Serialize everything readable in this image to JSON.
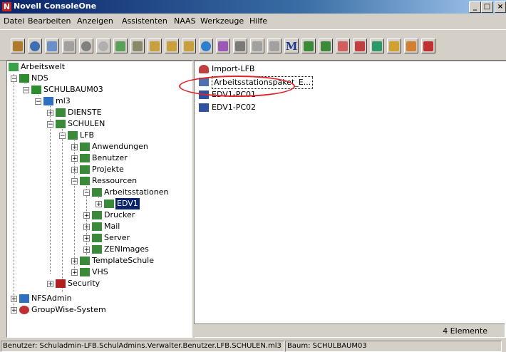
{
  "window": {
    "title": "Novell ConsoleOne",
    "app_icon": "N",
    "minimize": "_",
    "maximize": "□",
    "close": "×"
  },
  "menu": [
    "Datei",
    "Bearbeiten",
    "Anzeigen",
    "Assistenten",
    "NAAS",
    "Werkzeuge",
    "Hilfe"
  ],
  "toolbar": {
    "icons": [
      "exit-icon",
      "find-icon",
      "properties-icon",
      "copy-icon",
      "stop-icon",
      "refresh-icon",
      "help-icon",
      "folder-icon",
      "tree-icon",
      "tree2-icon",
      "tree3-icon",
      "network-icon",
      "report-icon",
      "list-icon",
      "users-icon",
      "arrow-icon",
      "M-icon",
      "plant-icon",
      "plant2-icon",
      "group-icon",
      "user-icon",
      "org-icon",
      "box-icon",
      "container-icon",
      "exit2-icon"
    ],
    "m_label": "M"
  },
  "tree": {
    "root": "Arbeitswelt",
    "nds": "NDS",
    "schulbaum": "SCHULBAUM03",
    "ml3": "ml3",
    "dienste": "DIENSTE",
    "schulen": "SCHULEN",
    "lfb": "LFB",
    "anwendungen": "Anwendungen",
    "benutzer": "Benutzer",
    "projekte": "Projekte",
    "ressourcen": "Ressourcen",
    "arbeitsstationen": "Arbeitsstationen",
    "edv1": "EDV1",
    "drucker": "Drucker",
    "mail": "Mail",
    "server": "Server",
    "zenimages": "ZENImages",
    "templateschule": "TemplateSchule",
    "vhs": "VHS",
    "security": "Security",
    "nfsadmin": "NFSAdmin",
    "groupwise": "GroupWise-System"
  },
  "items": [
    "Import-LFB",
    "Arbeitsstationspaket_E...",
    "EDV1-PC01",
    "EDV1-PC02"
  ],
  "status": {
    "count": "4 Elemente",
    "user": "Benutzer: Schuladmin-LFB.SchulAdmins.Verwalter.Benutzer.LFB.SCHULEN.ml3",
    "tree": "Baum: SCHULBAUM03"
  },
  "colors": {
    "accent": "#0a246a",
    "annotation": "#e0242a"
  }
}
